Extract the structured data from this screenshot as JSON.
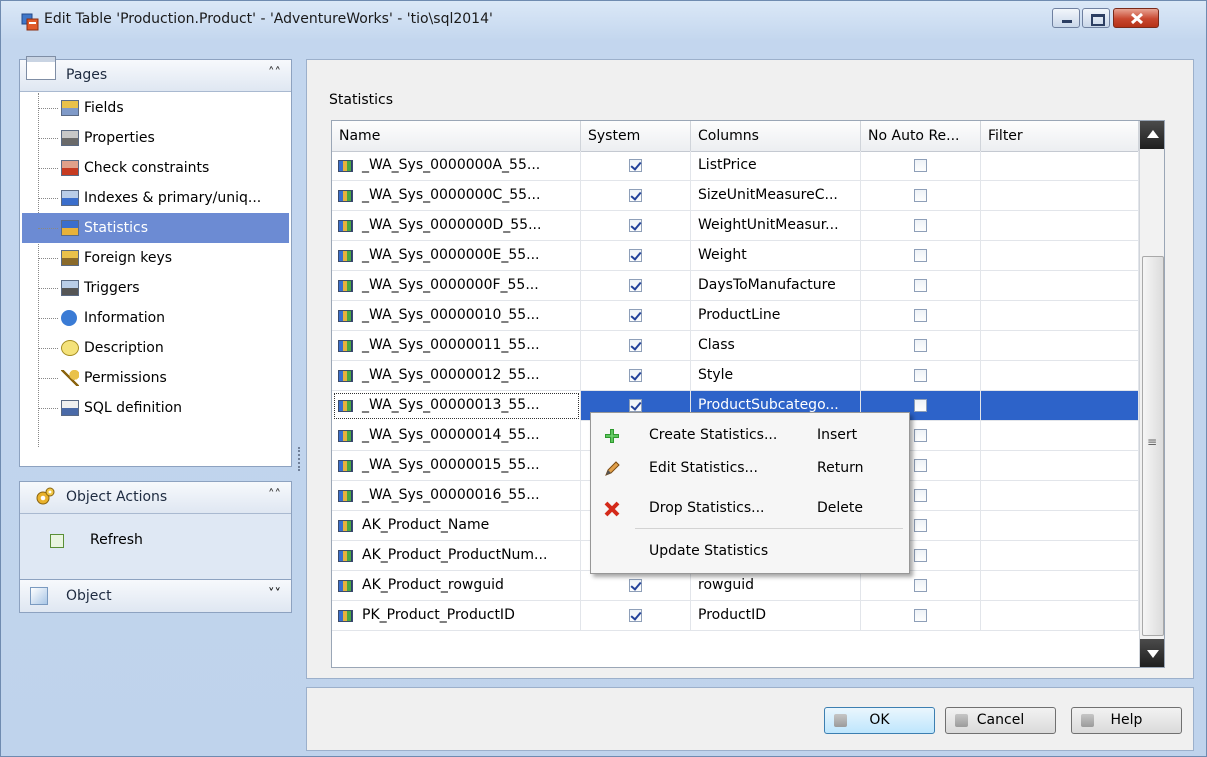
{
  "window": {
    "title": "Edit Table 'Production.Product' - 'AdventureWorks' - 'tio\\sql2014'"
  },
  "sidebar": {
    "pages_header": "Pages",
    "pages_collapse": "≈",
    "items": [
      {
        "label": "Fields",
        "icon": "fields-icon"
      },
      {
        "label": "Properties",
        "icon": "properties-icon"
      },
      {
        "label": "Check constraints",
        "icon": "check-constraints-icon"
      },
      {
        "label": "Indexes & primary/uniq...",
        "icon": "indexes-icon"
      },
      {
        "label": "Statistics",
        "icon": "statistics-icon",
        "selected": true
      },
      {
        "label": "Foreign keys",
        "icon": "foreign-keys-icon"
      },
      {
        "label": "Triggers",
        "icon": "triggers-icon"
      },
      {
        "label": "Information",
        "icon": "information-icon"
      },
      {
        "label": "Description",
        "icon": "description-icon"
      },
      {
        "label": "Permissions",
        "icon": "key-icon"
      },
      {
        "label": "SQL definition",
        "icon": "sql-icon"
      }
    ],
    "object_actions_header": "Object Actions",
    "refresh_label": "Refresh",
    "object_header": "Object"
  },
  "main": {
    "section_label": "Statistics",
    "columns": [
      "Name",
      "System",
      "Columns",
      "No Auto Re...",
      "Filter"
    ],
    "rows": [
      {
        "name": "_WA_Sys_0000000A_55...",
        "system": true,
        "columns": "ListPrice",
        "no_auto": false,
        "filter": ""
      },
      {
        "name": "_WA_Sys_0000000C_55...",
        "system": true,
        "columns": "SizeUnitMeasureC...",
        "no_auto": false,
        "filter": ""
      },
      {
        "name": "_WA_Sys_0000000D_55...",
        "system": true,
        "columns": "WeightUnitMeasur...",
        "no_auto": false,
        "filter": ""
      },
      {
        "name": "_WA_Sys_0000000E_55...",
        "system": true,
        "columns": "Weight",
        "no_auto": false,
        "filter": ""
      },
      {
        "name": "_WA_Sys_0000000F_55...",
        "system": true,
        "columns": "DaysToManufacture",
        "no_auto": false,
        "filter": ""
      },
      {
        "name": "_WA_Sys_00000010_55...",
        "system": true,
        "columns": "ProductLine",
        "no_auto": false,
        "filter": ""
      },
      {
        "name": "_WA_Sys_00000011_55...",
        "system": true,
        "columns": "Class",
        "no_auto": false,
        "filter": ""
      },
      {
        "name": "_WA_Sys_00000012_55...",
        "system": true,
        "columns": "Style",
        "no_auto": false,
        "filter": ""
      },
      {
        "name": "_WA_Sys_00000013_55...",
        "system": true,
        "columns": "ProductSubcatego...",
        "no_auto": false,
        "filter": "",
        "selected": true
      },
      {
        "name": "_WA_Sys_00000014_55...",
        "system": true,
        "columns": "",
        "no_auto": false,
        "filter": ""
      },
      {
        "name": "_WA_Sys_00000015_55...",
        "system": true,
        "columns": "",
        "no_auto": false,
        "filter": ""
      },
      {
        "name": "_WA_Sys_00000016_55...",
        "system": true,
        "columns": "",
        "no_auto": false,
        "filter": ""
      },
      {
        "name": "AK_Product_Name",
        "system": false,
        "columns": "",
        "no_auto": false,
        "filter": ""
      },
      {
        "name": "AK_Product_ProductNum...",
        "system": false,
        "columns": "",
        "no_auto": false,
        "filter": ""
      },
      {
        "name": "AK_Product_rowguid",
        "system": true,
        "columns": "rowguid",
        "no_auto": false,
        "filter": ""
      },
      {
        "name": "PK_Product_ProductID",
        "system": true,
        "columns": "ProductID",
        "no_auto": false,
        "filter": ""
      }
    ]
  },
  "context_menu": {
    "items": [
      {
        "label": "Create Statistics...",
        "shortcut": "Insert",
        "icon": "plus-icon"
      },
      {
        "label": "Edit Statistics...",
        "shortcut": "Return",
        "icon": "pencil-icon"
      },
      {
        "label": "Drop Statistics...",
        "shortcut": "Delete",
        "icon": "red-x-icon"
      },
      {
        "label": "Update Statistics",
        "shortcut": "",
        "icon": ""
      }
    ]
  },
  "footer": {
    "ok_label": "OK",
    "cancel_label": "Cancel",
    "help_label": "Help"
  },
  "colors": {
    "selection_blue": "#2d63c9",
    "sidebar_selected": "#6c8bd3",
    "window_frame": "#c3d6ee",
    "close_red": "#c8472f"
  }
}
